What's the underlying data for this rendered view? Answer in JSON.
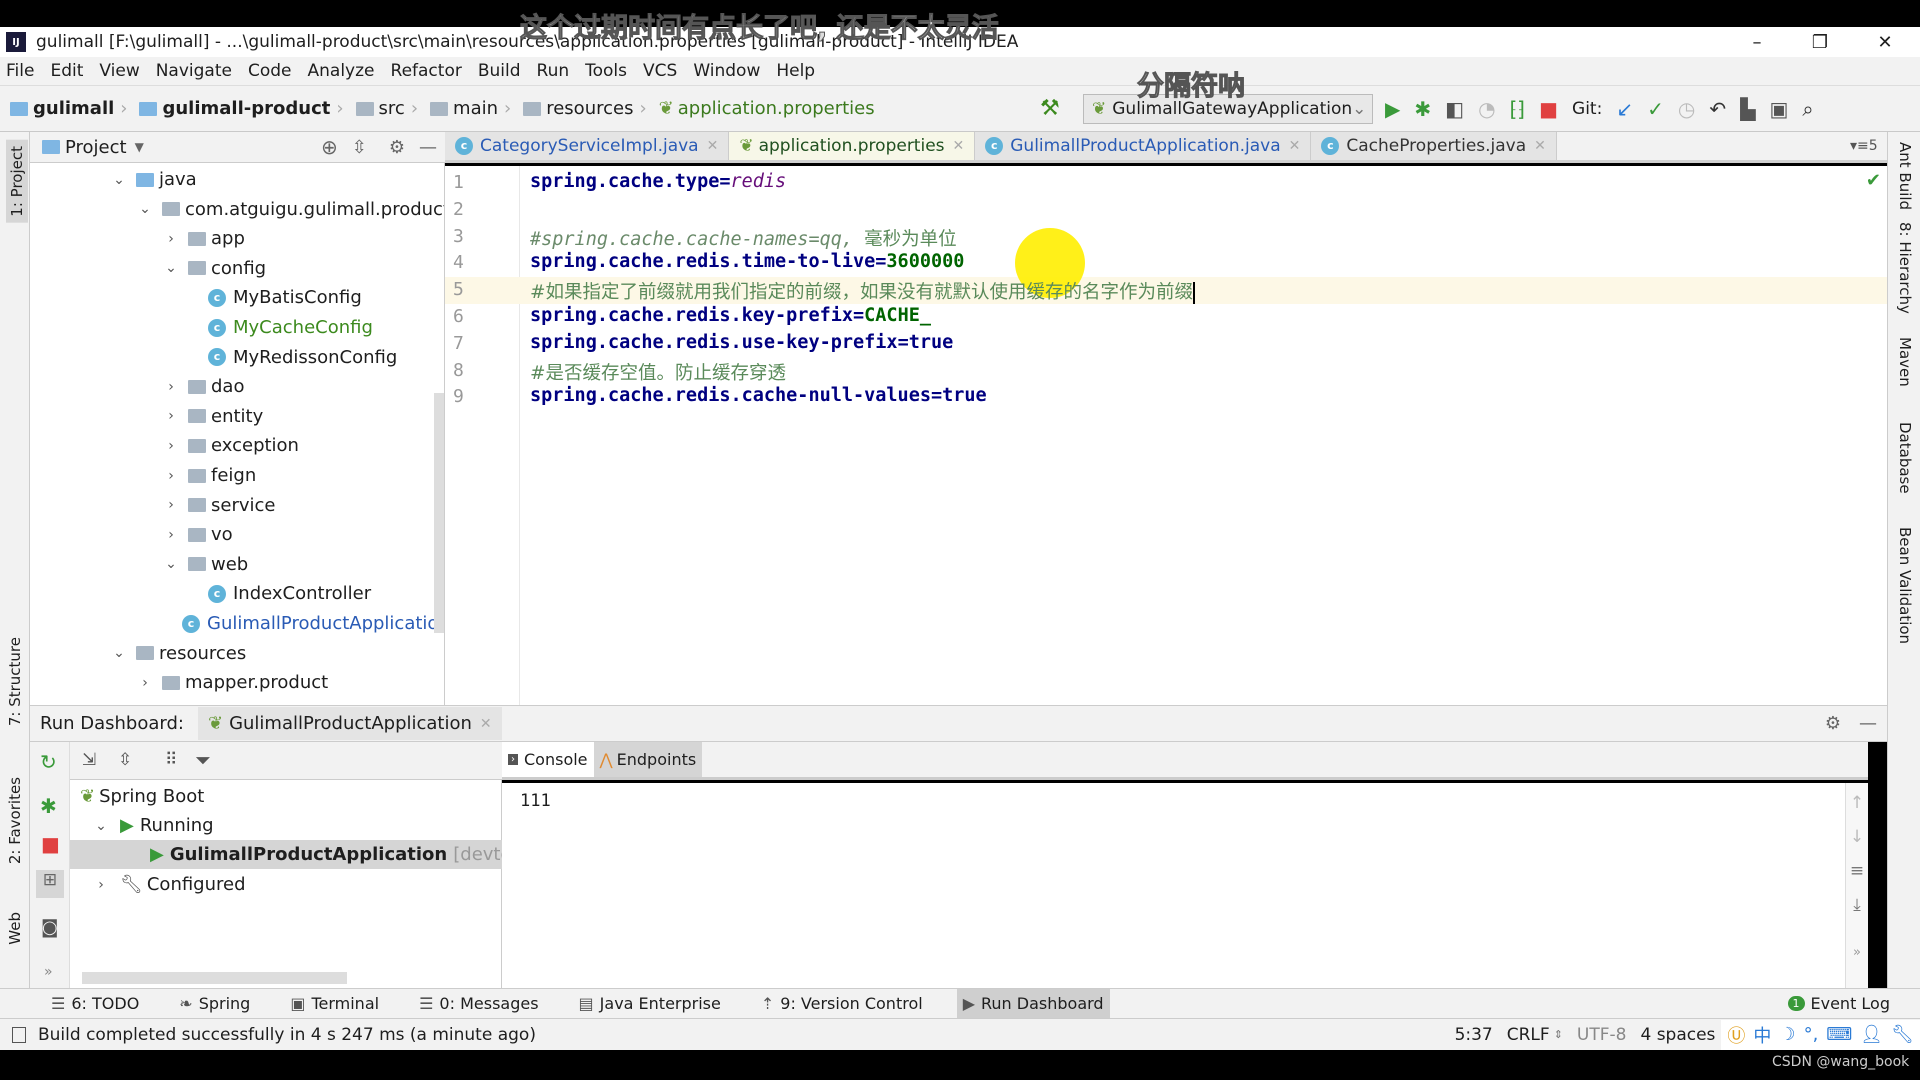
{
  "window": {
    "title": "gulimall [F:\\gulimall] - ...\\gulimall-product\\src\\main\\resources\\application.properties [gulimall-product] - IntelliJ IDEA",
    "logo": "IJ"
  },
  "menu": [
    "File",
    "Edit",
    "View",
    "Navigate",
    "Code",
    "Analyze",
    "Refactor",
    "Build",
    "Run",
    "Tools",
    "VCS",
    "Window",
    "Help"
  ],
  "breadcrumb": [
    "gulimall",
    "gulimall-product",
    "src",
    "main",
    "resources",
    "application.properties"
  ],
  "toolbar": {
    "run_config": "GulimallGatewayApplication",
    "git_label": "Git:"
  },
  "left_stripe": {
    "project": "1: Project",
    "structure": "7: Structure",
    "favorites": "2: Favorites",
    "web": "Web"
  },
  "right_stripe": [
    "Ant Build",
    "8: Hierarchy",
    "Maven",
    "Database",
    "Bean Validation"
  ],
  "project": {
    "title": "Project",
    "tree": [
      {
        "label": "java",
        "indent": 0,
        "chev": "v",
        "icon": "folder"
      },
      {
        "label": "com.atguigu.gulimall.product",
        "indent": 1,
        "chev": "v",
        "icon": "package"
      },
      {
        "label": "app",
        "indent": 2,
        "chev": ">",
        "icon": "package"
      },
      {
        "label": "config",
        "indent": 2,
        "chev": "v",
        "icon": "package"
      },
      {
        "label": "MyBatisConfig",
        "indent": 3,
        "chev": "",
        "icon": "class"
      },
      {
        "label": "MyCacheConfig",
        "indent": 3,
        "chev": "",
        "icon": "class",
        "color": "#3c8a1e"
      },
      {
        "label": "MyRedissonConfig",
        "indent": 3,
        "chev": "",
        "icon": "class"
      },
      {
        "label": "dao",
        "indent": 2,
        "chev": ">",
        "icon": "package"
      },
      {
        "label": "entity",
        "indent": 2,
        "chev": ">",
        "icon": "package"
      },
      {
        "label": "exception",
        "indent": 2,
        "chev": ">",
        "icon": "package"
      },
      {
        "label": "feign",
        "indent": 2,
        "chev": ">",
        "icon": "package"
      },
      {
        "label": "service",
        "indent": 2,
        "chev": ">",
        "icon": "package"
      },
      {
        "label": "vo",
        "indent": 2,
        "chev": ">",
        "icon": "package"
      },
      {
        "label": "web",
        "indent": 2,
        "chev": "v",
        "icon": "package"
      },
      {
        "label": "IndexController",
        "indent": 3,
        "chev": "",
        "icon": "class"
      },
      {
        "label": "GulimallProductApplication",
        "indent": 2,
        "chev": "",
        "icon": "spring-class",
        "color": "#2a5bb5"
      },
      {
        "label": "resources",
        "indent": 0,
        "chev": "v",
        "icon": "resources"
      },
      {
        "label": "mapper.product",
        "indent": 1,
        "chev": ">",
        "icon": "package"
      }
    ]
  },
  "tabs": [
    {
      "label": "CategoryServiceImpl.java",
      "active": false
    },
    {
      "label": "application.properties",
      "active": true
    },
    {
      "label": "GulimallProductApplication.java",
      "active": false
    },
    {
      "label": "CacheProperties.java",
      "active": false
    }
  ],
  "tab_overflow": "5",
  "editor": {
    "current_line": 5,
    "lines": [
      {
        "n": "1",
        "key": "spring.cache.type",
        "eq": "=",
        "value": "redis",
        "style": "italic"
      },
      {
        "n": "2"
      },
      {
        "n": "3",
        "comment": "#spring.cache.cache-names=qq, ",
        "comment_zh": "毫秒为单位"
      },
      {
        "n": "4",
        "key": "spring.cache.redis.time-to-live",
        "eq": "=",
        "value": "3600000",
        "style": "green"
      },
      {
        "n": "5",
        "comment_zh": "#如果指定了前缀就用我们指定的前缀，如果没有就默认使用缓存的名字作为前缀"
      },
      {
        "n": "6",
        "key": "spring.cache.redis.key-prefix",
        "eq": "=",
        "value": "CACHE_",
        "style": "green"
      },
      {
        "n": "7",
        "key": "spring.cache.redis.use-key-prefix",
        "eq": "=",
        "value": "true",
        "style": "plain"
      },
      {
        "n": "8",
        "comment_zh": "#是否缓存空值。防止缓存穿透"
      },
      {
        "n": "9",
        "key": "spring.cache.redis.cache-null-values",
        "eq": "=",
        "value": "true",
        "style": "plain"
      }
    ]
  },
  "run_dashboard": {
    "label": "Run Dashboard:",
    "tab": "GulimallProductApplication",
    "tree": {
      "spring_boot": "Spring Boot",
      "running": "Running",
      "app": "GulimallProductApplication",
      "app_suffix": "[devtools]",
      "configured": "Configured"
    },
    "console_tabs": [
      "Console",
      "Endpoints"
    ],
    "console_output": "111"
  },
  "tool_windows": [
    {
      "label": "6: TODO"
    },
    {
      "label": "Spring"
    },
    {
      "label": "Terminal"
    },
    {
      "label": "0: Messages"
    },
    {
      "label": "Java Enterprise"
    },
    {
      "label": "9: Version Control"
    },
    {
      "label": "Run Dashboard",
      "active": true
    }
  ],
  "event_log": {
    "label": "Event Log",
    "count": "1"
  },
  "status": {
    "message": "Build completed successfully in 4 s 247 ms (a minute ago)",
    "position": "5:37",
    "line_sep": "CRLF",
    "encoding": "UTF-8",
    "indent": "4 spaces",
    "ime": "中"
  },
  "overlays": {
    "caption_top": "这个过期时间有点长了吧, 还是不太灵活",
    "caption_mid": "分隔符呐",
    "watermark": "CSDN @wang_book"
  }
}
